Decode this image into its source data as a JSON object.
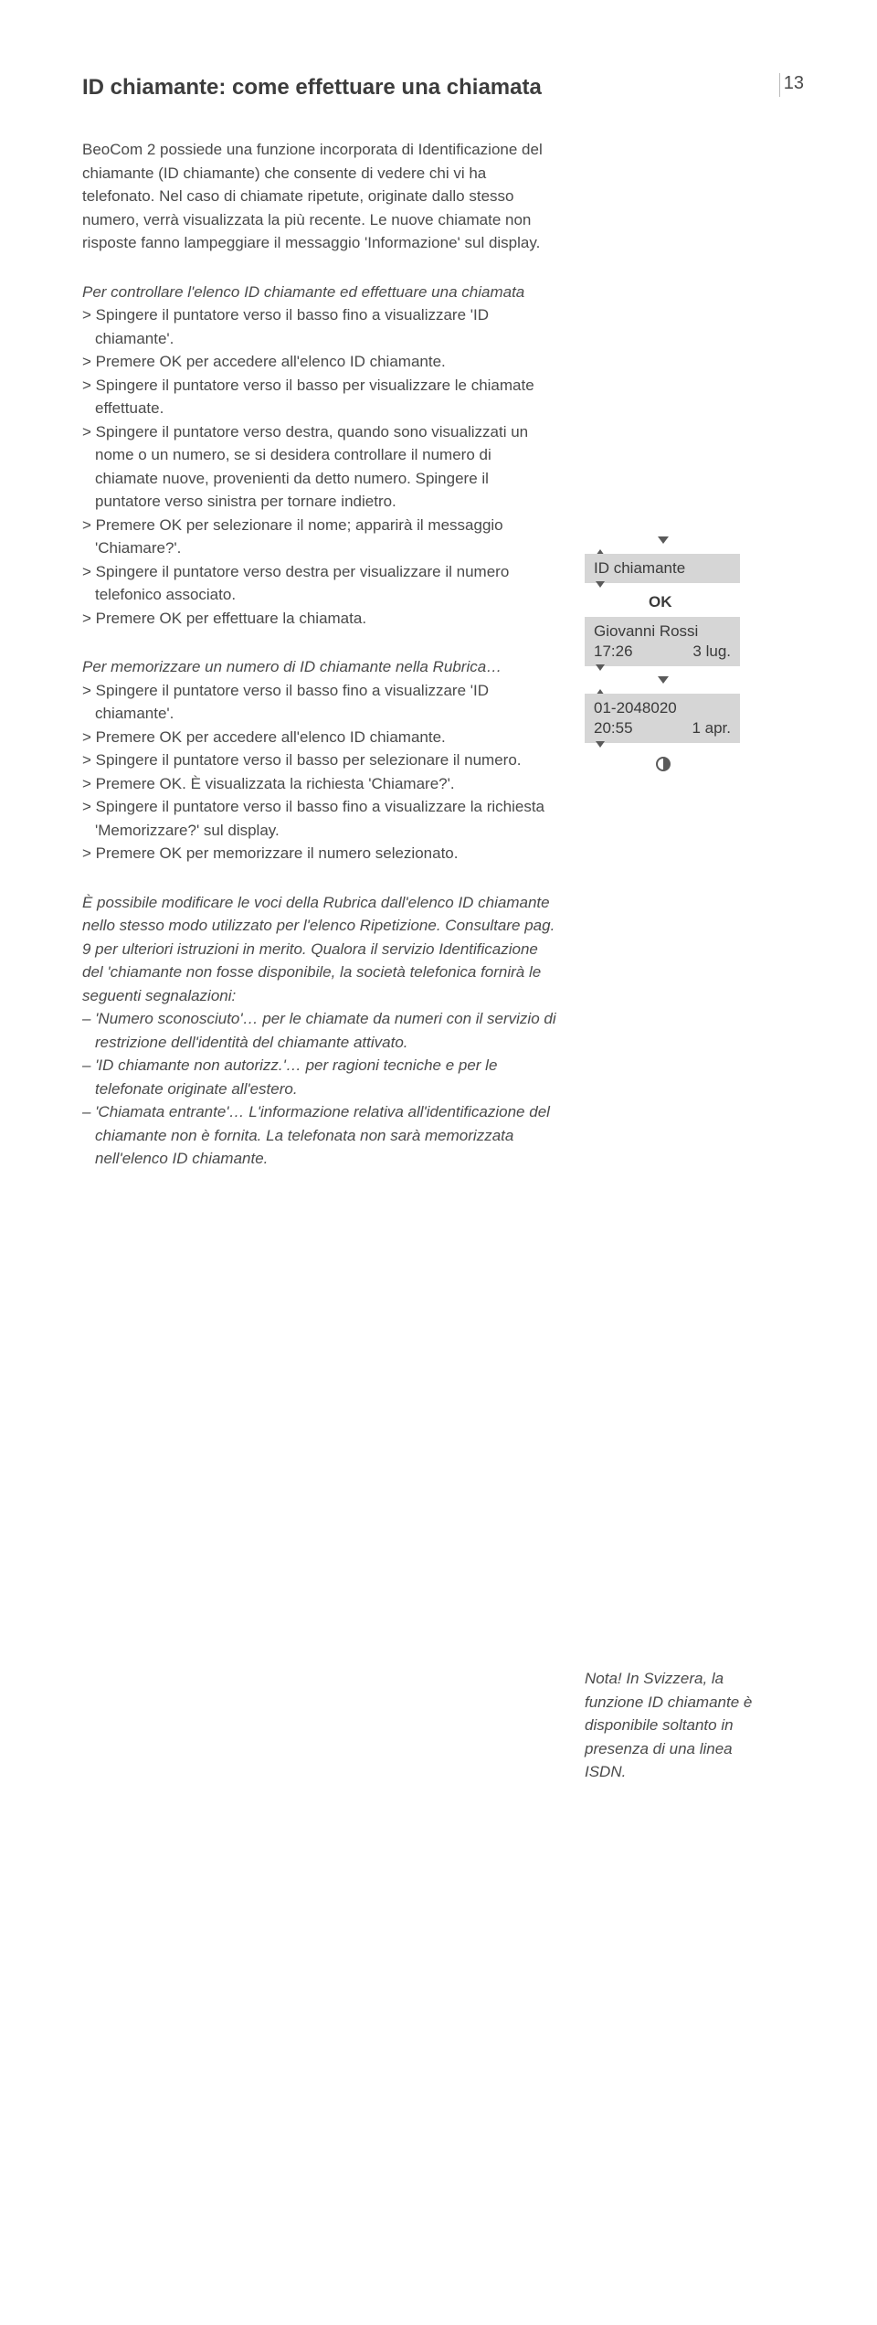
{
  "pagenum": "13",
  "title": "ID chiamante: come effettuare una chiamata",
  "intro": "BeoCom 2 possiede una funzione incorporata di Identificazione del chiamante (ID chiamante) che consente di vedere chi vi ha telefonato. Nel caso di chiamate ripetute, originate dallo stesso numero, verrà visualizzata la più recente. Le nuove chiamate non risposte fanno lampeggiare il messaggio 'Informazione' sul display.",
  "section1": {
    "title": "Per controllare l'elenco ID chiamante ed effettuare una chiamata",
    "steps": [
      "> Spingere il puntatore verso il basso fino a visualizzare 'ID chiamante'.",
      "> Premere OK per accedere all'elenco ID chiamante.",
      "> Spingere il puntatore verso il basso per visualizzare le chiamate effettuate.",
      "> Spingere il puntatore verso destra, quando sono visualizzati un nome o un numero, se si desidera controllare il numero di chiamate nuove, provenienti da detto numero. Spingere il puntatore verso sinistra per tornare indietro.",
      "> Premere OK per selezionare il nome; apparirà il messaggio 'Chiamare?'.",
      "> Spingere il puntatore verso destra per visualizzare il numero telefonico associato.",
      "> Premere OK per effettuare la chiamata."
    ]
  },
  "section2": {
    "title": "Per memorizzare un numero di ID chiamante nella Rubrica…",
    "steps": [
      "> Spingere il puntatore verso il basso fino a visualizzare 'ID chiamante'.",
      "> Premere OK per accedere all'elenco ID chiamante.",
      "> Spingere il puntatore verso il basso per selezionare il numero.",
      "> Premere OK. È visualizzata la richiesta 'Chiamare?'.",
      "> Spingere il puntatore verso il basso fino a visualizzare la richiesta 'Memorizzare?' sul display.",
      "> Premere OK per memorizzare il numero selezionato."
    ]
  },
  "section3": {
    "intro": "È possibile modificare le voci della Rubrica dall'elenco ID chiamante nello stesso modo utilizzato per l'elenco Ripetizione. Consultare pag. 9 per ulteriori istruzioni in merito. Qualora il servizio Identificazione del 'chiamante non fosse disponibile, la società telefonica fornirà le seguenti segnalazioni:",
    "bullets": [
      "– 'Numero sconosciuto'… per le chiamate da numeri con il servizio di restrizione dell'identità del chiamante attivato.",
      "– 'ID chiamante non autorizz.'… per ragioni tecniche e per le telefonate originate all'estero.",
      "– 'Chiamata entrante'… L'informazione relativa all'identificazione del chiamante non è fornita. La telefonata non sarà memorizzata nell'elenco ID chiamante."
    ]
  },
  "displays": {
    "d1": {
      "line1": "ID chiamante"
    },
    "ok": "OK",
    "d2": {
      "name": "Giovanni Rossi",
      "time": "17:26",
      "date": "3 lug."
    },
    "d3": {
      "number": "01-2048020",
      "time": "20:55",
      "date": "1 apr."
    }
  },
  "side_note": "Nota! In Svizzera, la funzione ID chiamante è disponibile soltanto in presenza di una linea ISDN."
}
